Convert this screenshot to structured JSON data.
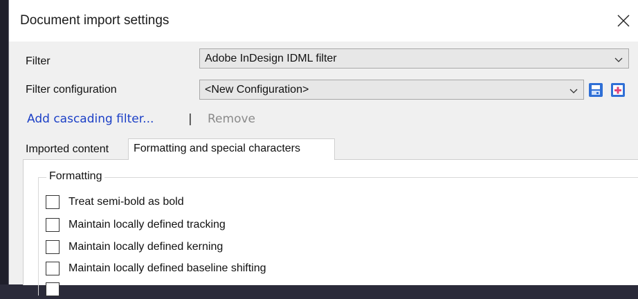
{
  "dialog": {
    "title": "Document import settings",
    "close_icon": "close-icon"
  },
  "filter": {
    "label": "Filter",
    "value": "Adobe InDesign IDML filter"
  },
  "filter_configuration": {
    "label": "Filter configuration",
    "value": "<New Configuration>",
    "save_icon": "save-config-icon",
    "new_icon": "add-config-icon"
  },
  "cascade": {
    "add_label": "Add cascading filter...",
    "separator": "|",
    "remove_label": "Remove"
  },
  "tabs": [
    {
      "label": "Imported content",
      "active": false
    },
    {
      "label": "Formatting and special characters",
      "active": true
    }
  ],
  "formatting": {
    "group_title": "Formatting",
    "options": [
      {
        "label": "Treat semi-bold as bold",
        "checked": false
      },
      {
        "label": "Maintain locally defined tracking",
        "checked": false
      },
      {
        "label": "Maintain locally defined kerning",
        "checked": false
      },
      {
        "label": "Maintain locally defined baseline shifting",
        "checked": false
      }
    ]
  },
  "colors": {
    "link": "#1b3fc6",
    "icon_blue": "#2f6fd6",
    "icon_pink": "#e0457a"
  }
}
